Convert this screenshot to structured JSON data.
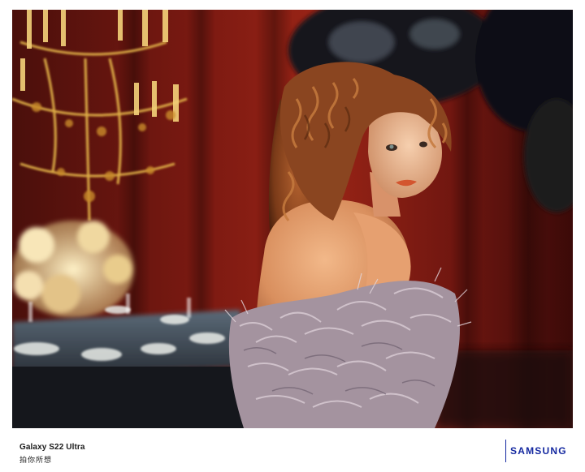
{
  "photo": {
    "alt": "Photo of a woman with curly auburn hair wearing a feathered garment, glancing over her shoulder in a red-curtained room with a gold chandelier and set dining table"
  },
  "footer": {
    "product_name": "Galaxy S22 Ultra",
    "tagline": "拍你所想",
    "brand": "SAMSUNG"
  },
  "colors": {
    "brand_blue": "#1428a0",
    "curtain_red": "#8a1b14",
    "chandelier_gold": "#d8a83a",
    "feather_lilac": "#b9a8b8"
  }
}
